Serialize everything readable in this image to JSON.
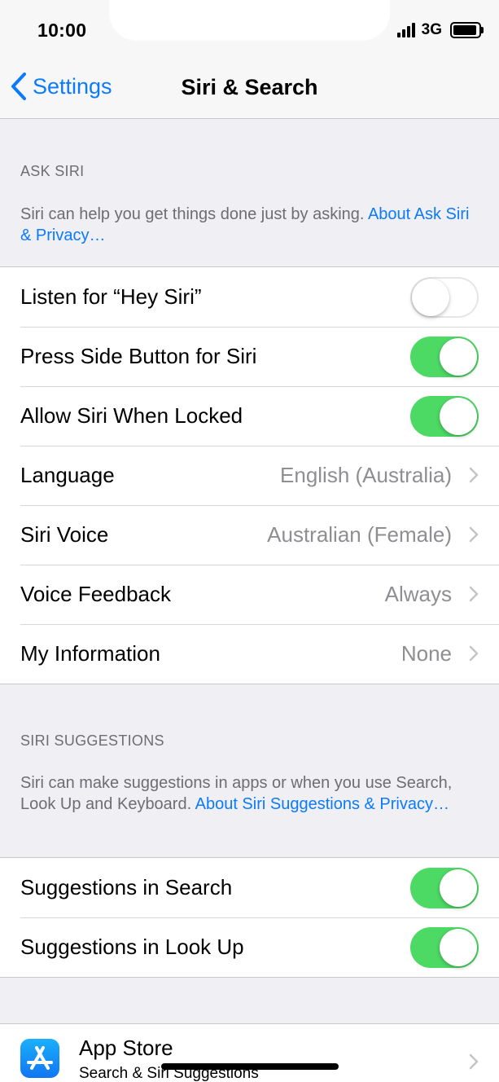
{
  "status": {
    "time": "10:00",
    "network": "3G"
  },
  "nav": {
    "back_label": "Settings",
    "title": "Siri & Search"
  },
  "ask_siri": {
    "header": "ASK SIRI",
    "footer_text": "Siri can help you get things done just by asking. ",
    "footer_link": "About Ask Siri & Privacy…",
    "rows": [
      {
        "label": "Listen for “Hey Siri”",
        "toggle": "off"
      },
      {
        "label": "Press Side Button for Siri",
        "toggle": "on"
      },
      {
        "label": "Allow Siri When Locked",
        "toggle": "on"
      },
      {
        "label": "Language",
        "value": "English (Australia)"
      },
      {
        "label": "Siri Voice",
        "value": "Australian (Female)"
      },
      {
        "label": "Voice Feedback",
        "value": "Always"
      },
      {
        "label": "My Information",
        "value": "None"
      }
    ]
  },
  "siri_suggestions": {
    "header": "SIRI SUGGESTIONS",
    "footer_text": "Siri can make suggestions in apps or when you use Search, Look Up and Keyboard. ",
    "footer_link": "About Siri Suggestions & Privacy…",
    "rows": [
      {
        "label": "Suggestions in Search",
        "toggle": "on"
      },
      {
        "label": "Suggestions in Look Up",
        "toggle": "on"
      }
    ]
  },
  "apps": [
    {
      "name": "App Store",
      "subtitle": "Search & Siri Suggestions",
      "icon": "app-store-icon"
    }
  ],
  "colors": {
    "accent": "#0a7aff",
    "toggle_on": "#4cd964",
    "background": "#efeff4"
  }
}
